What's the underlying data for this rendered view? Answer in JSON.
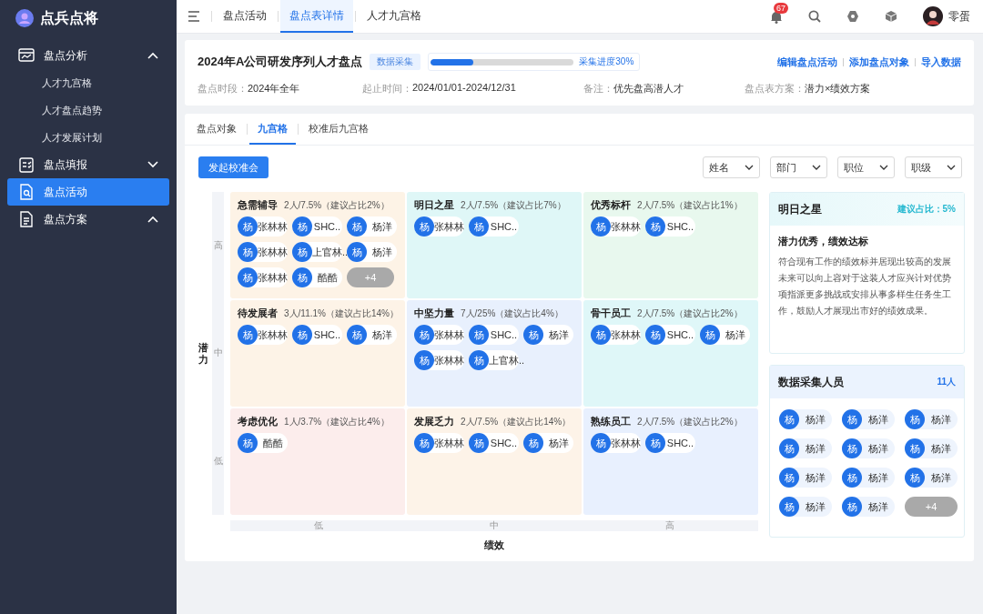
{
  "app": {
    "name": "点兵点将"
  },
  "sidebar": {
    "items": [
      {
        "kind": "group",
        "label": "盘点分析",
        "expanded": true,
        "selected": false,
        "children": [
          {
            "label": "人才九宫格",
            "selected": false
          },
          {
            "label": "人才盘点趋势",
            "selected": false
          },
          {
            "label": "人才发展计划",
            "selected": false
          }
        ]
      },
      {
        "kind": "group",
        "label": "盘点填报",
        "expanded": false,
        "selected": false
      },
      {
        "kind": "item",
        "label": "盘点活动",
        "selected": true
      },
      {
        "kind": "group",
        "label": "盘点方案",
        "expanded": true,
        "selected": false
      }
    ]
  },
  "topbar": {
    "tabs": [
      {
        "label": "盘点活动",
        "selected": false
      },
      {
        "label": "盘点表详情",
        "selected": true
      },
      {
        "label": "人才九宫格",
        "selected": false
      }
    ],
    "notifications": "67",
    "user": "零蛋"
  },
  "header": {
    "title": "2024年A公司研发序列人才盘点",
    "tag": "数据采集",
    "progress": {
      "level": 0.3,
      "label": "采集进度30%"
    },
    "actions": [
      "编辑盘点活动",
      "添加盘点对象",
      "导入数据"
    ],
    "meta": [
      {
        "label": "盘点时段：",
        "value": "2024年全年"
      },
      {
        "label": "起止时间：",
        "value": "2024/01/01-2024/12/31"
      },
      {
        "label": "备注：",
        "value": "优先盘高潜人才"
      },
      {
        "label": "盘点表方案：",
        "value": "潜力×绩效方案"
      }
    ]
  },
  "tabs": [
    {
      "label": "盘点对象",
      "selected": false
    },
    {
      "label": "九宫格",
      "selected": true
    },
    {
      "label": "校准后九宫格",
      "selected": false
    }
  ],
  "start_button": "发起校准会",
  "filters": [
    {
      "label": "姓名"
    },
    {
      "label": "部门"
    },
    {
      "label": "职位"
    },
    {
      "label": "职级"
    }
  ],
  "grid": {
    "y_axis": {
      "title": "潜力",
      "ticks": [
        "高",
        "中",
        "低"
      ]
    },
    "x_axis": {
      "title": "绩效",
      "ticks": [
        "低",
        "中",
        "高"
      ]
    },
    "cells": [
      {
        "title": "急需辅导",
        "stats": "2人/7.5%（建议占比2%）",
        "color": "#fdf3e6",
        "members": [
          {
            "avatar": "杨",
            "name": "张林林"
          },
          {
            "avatar": "杨",
            "name": "SHC.."
          },
          {
            "avatar": "杨",
            "name": "杨洋"
          },
          {
            "avatar": "杨",
            "name": "张林林"
          },
          {
            "avatar": "杨",
            "name": "上官林.."
          },
          {
            "avatar": "杨",
            "name": "杨洋"
          },
          {
            "avatar": "杨",
            "name": "张林林"
          },
          {
            "avatar": "杨",
            "name": "酷酷"
          }
        ],
        "more": "+4"
      },
      {
        "title": "明日之星",
        "stats": "2人/7.5%（建议占比7%）",
        "color": "#dff7f7",
        "members": [
          {
            "avatar": "杨",
            "name": "张林林"
          },
          {
            "avatar": "杨",
            "name": "SHC.."
          }
        ]
      },
      {
        "title": "优秀标杆",
        "stats": "2人/7.5%（建议占比1%）",
        "color": "#e8f8ee",
        "members": [
          {
            "avatar": "杨",
            "name": "张林林"
          },
          {
            "avatar": "杨",
            "name": "SHC.."
          }
        ]
      },
      {
        "title": "待发展者",
        "stats": "3人/11.1%（建议占比14%）",
        "color": "#fdf3e7",
        "members": [
          {
            "avatar": "杨",
            "name": "张林林"
          },
          {
            "avatar": "杨",
            "name": "SHC.."
          },
          {
            "avatar": "杨",
            "name": "杨洋"
          }
        ]
      },
      {
        "title": "中坚力量",
        "stats": "7人/25%（建议占比4%）",
        "color": "#e8f0fd",
        "members": [
          {
            "avatar": "杨",
            "name": "张林林"
          },
          {
            "avatar": "杨",
            "name": "SHC.."
          },
          {
            "avatar": "杨",
            "name": "杨洋"
          },
          {
            "avatar": "杨",
            "name": "张林林"
          },
          {
            "avatar": "杨",
            "name": "上官林.."
          }
        ]
      },
      {
        "title": "骨干员工",
        "stats": "2人/7.5%（建议占比2%）",
        "color": "#dff7f8",
        "members": [
          {
            "avatar": "杨",
            "name": "张林林"
          },
          {
            "avatar": "杨",
            "name": "SHC.."
          },
          {
            "avatar": "杨",
            "name": "杨洋"
          }
        ]
      },
      {
        "title": "考虑优化",
        "stats": "1人/3.7%（建议占比4%）",
        "color": "#fcedec",
        "members": [
          {
            "avatar": "杨",
            "name": "酷酷"
          }
        ]
      },
      {
        "title": "发展乏力",
        "stats": "2人/7.5%（建议占比14%）",
        "color": "#fdf3e8",
        "members": [
          {
            "avatar": "杨",
            "name": "张林林"
          },
          {
            "avatar": "杨",
            "name": "SHC.."
          },
          {
            "avatar": "杨",
            "name": "杨洋"
          }
        ]
      },
      {
        "title": "熟练员工",
        "stats": "2人/7.5%（建议占比2%）",
        "color": "#e8f0fe",
        "members": [
          {
            "avatar": "杨",
            "name": "张林林"
          },
          {
            "avatar": "杨",
            "name": "SHC.."
          }
        ]
      }
    ]
  },
  "detail": {
    "title": "明日之星",
    "ratio": "建议占比：5%",
    "subtitle": "潜力优秀，绩效达标",
    "description": "符合现有工作的绩效标并居现出较高的发展未来可以向上容对于这装人才应兴计对优势项指派更多挑战或安排从事多样生任务生工作，鼓励人才展现出市好的绩效成果。"
  },
  "collectors": {
    "title": "数据采集人员",
    "count": "11人",
    "members": [
      {
        "avatar": "杨",
        "name": "杨洋"
      },
      {
        "avatar": "杨",
        "name": "杨洋"
      },
      {
        "avatar": "杨",
        "name": "杨洋"
      },
      {
        "avatar": "杨",
        "name": "杨洋"
      },
      {
        "avatar": "杨",
        "name": "杨洋"
      },
      {
        "avatar": "杨",
        "name": "杨洋"
      },
      {
        "avatar": "杨",
        "name": "杨洋"
      },
      {
        "avatar": "杨",
        "name": "杨洋"
      },
      {
        "avatar": "杨",
        "name": "杨洋"
      },
      {
        "avatar": "杨",
        "name": "杨洋"
      },
      {
        "avatar": "杨",
        "name": "杨洋"
      }
    ],
    "more": "+4"
  }
}
